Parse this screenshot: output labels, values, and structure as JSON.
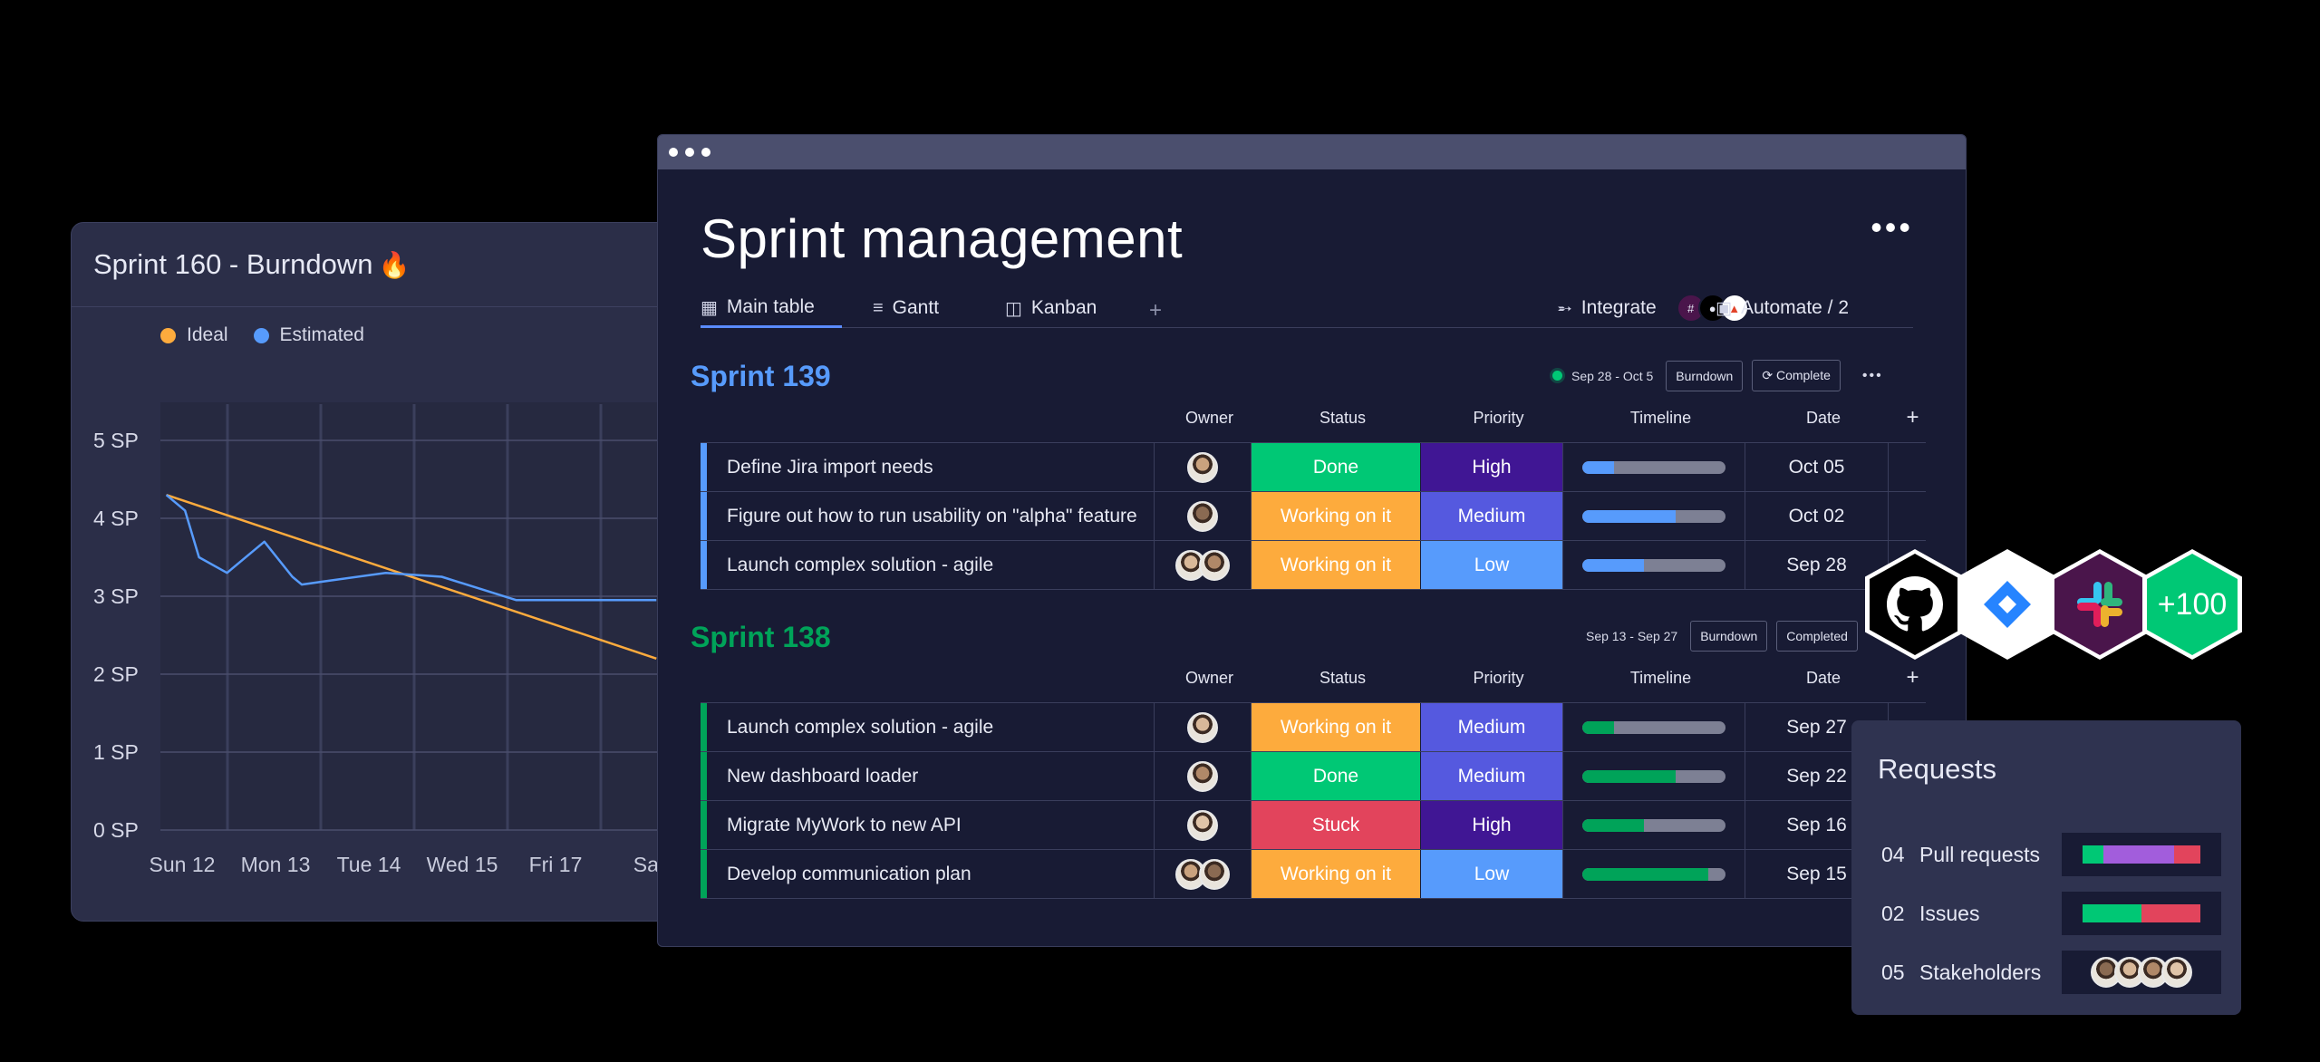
{
  "burndown": {
    "title": "Sprint 160 - Burndown",
    "title_icon": "fire-icon",
    "legend": [
      {
        "label": "Ideal",
        "color": "#fdab3d"
      },
      {
        "label": "Estimated",
        "color": "#579bfc"
      }
    ],
    "chart_data": {
      "type": "line",
      "title": "Sprint 160 - Burndown",
      "y_tick_labels": [
        "5 SP",
        "4 SP",
        "3 SP",
        "2 SP",
        "1 SP",
        "0 SP"
      ],
      "x_tick_labels": [
        "Sun 12",
        "Mon 13",
        "Tue 14",
        "Wed 15",
        "Fri 17",
        "Sat"
      ],
      "ylim": [
        0,
        5
      ],
      "grid": true,
      "legend_position": "top-left",
      "series": [
        {
          "name": "Ideal",
          "color": "#fdab3d",
          "x": [
            -0.15,
            5.1
          ],
          "y": [
            4.3,
            2.2
          ]
        },
        {
          "name": "Estimated",
          "color": "#579bfc",
          "x": [
            -0.15,
            0.05,
            0.2,
            0.5,
            0.9,
            1.2,
            1.3,
            1.6,
            2.2,
            2.8,
            3.6,
            4.5,
            5.1
          ],
          "y": [
            4.3,
            4.1,
            3.5,
            3.3,
            3.7,
            3.25,
            3.15,
            3.2,
            3.3,
            3.25,
            2.95,
            2.95,
            2.95
          ]
        }
      ]
    }
  },
  "window": {
    "title": "Sprint management",
    "more_label": "•••",
    "tabs": [
      {
        "label": "Main table",
        "icon": "table-icon"
      },
      {
        "label": "Gantt",
        "icon": "gantt-icon"
      },
      {
        "label": "Kanban",
        "icon": "kanban-icon"
      }
    ],
    "add_tab": "+",
    "integrate_label": "Integrate",
    "automate_label": "Automate / 2",
    "columns": [
      "Owner",
      "Status",
      "Priority",
      "Timeline",
      "Date"
    ],
    "add_column": "+"
  },
  "sprints": [
    {
      "name": "Sprint 139",
      "color": "#579bfc",
      "dates": "Sep 28 - Oct 5",
      "burndown_btn": "Burndown",
      "complete_btn": "Complete",
      "more": "•••",
      "rows": [
        {
          "task": "Define Jira import needs",
          "status": "Done",
          "status_color": "#00c875",
          "priority": "High",
          "priority_color": "#401694",
          "timeline": 0.22,
          "timeline_color": "#579bfc",
          "date": "Oct 05",
          "avatars": 1
        },
        {
          "task": "Figure out how to run usability on \"alpha\" feature",
          "status": "Working on it",
          "status_color": "#fdab3d",
          "priority": "Medium",
          "priority_color": "#5559df",
          "timeline": 0.65,
          "timeline_color": "#579bfc",
          "date": "Oct 02",
          "avatars": 1
        },
        {
          "task": "Launch complex solution - agile",
          "status": "Working on it",
          "status_color": "#fdab3d",
          "priority": "Low",
          "priority_color": "#579bfc",
          "timeline": 0.43,
          "timeline_color": "#579bfc",
          "date": "Sep 28",
          "avatars": 2
        }
      ]
    },
    {
      "name": "Sprint 138",
      "color": "#00a359",
      "dates": "Sep 13 - Sep 27",
      "burndown_btn": "Burndown",
      "complete_btn": "Completed",
      "rows": [
        {
          "task": "Launch complex solution - agile",
          "status": "Working on it",
          "status_color": "#fdab3d",
          "priority": "Medium",
          "priority_color": "#5559df",
          "timeline": 0.22,
          "timeline_color": "#00a359",
          "date": "Sep 27",
          "avatars": 1
        },
        {
          "task": "New dashboard loader",
          "status": "Done",
          "status_color": "#00c875",
          "priority": "Medium",
          "priority_color": "#5559df",
          "timeline": 0.65,
          "timeline_color": "#00a359",
          "date": "Sep 22",
          "avatars": 1
        },
        {
          "task": "Migrate MyWork to new API",
          "status": "Stuck",
          "status_color": "#e2445c",
          "priority": "High",
          "priority_color": "#401694",
          "timeline": 0.43,
          "timeline_color": "#00a359",
          "date": "Sep 16",
          "avatars": 1
        },
        {
          "task": "Develop communication plan",
          "status": "Working on it",
          "status_color": "#fdab3d",
          "priority": "Low",
          "priority_color": "#579bfc",
          "timeline": 0.88,
          "timeline_color": "#00a359",
          "date": "Sep 15",
          "avatars": 2
        }
      ]
    }
  ],
  "integrations": [
    {
      "name": "github-icon",
      "bg": "#000000"
    },
    {
      "name": "jira-icon",
      "bg": "#ffffff"
    },
    {
      "name": "slack-icon",
      "bg": "#4a154b"
    },
    {
      "name": "more-integrations",
      "label": "+100",
      "bg": "#00c875"
    }
  ],
  "requests": {
    "title": "Requests",
    "items": [
      {
        "num": "04",
        "label": "Pull requests",
        "segments": [
          {
            "color": "#00c875",
            "share": 0.18
          },
          {
            "color": "#a25ddc",
            "share": 0.6
          },
          {
            "color": "#e2445c",
            "share": 0.22
          }
        ]
      },
      {
        "num": "02",
        "label": "Issues",
        "segments": [
          {
            "color": "#00c875",
            "share": 0.5
          },
          {
            "color": "#e2445c",
            "share": 0.5
          }
        ]
      },
      {
        "num": "05",
        "label": "Stakeholders",
        "avatars": 4
      }
    ]
  }
}
